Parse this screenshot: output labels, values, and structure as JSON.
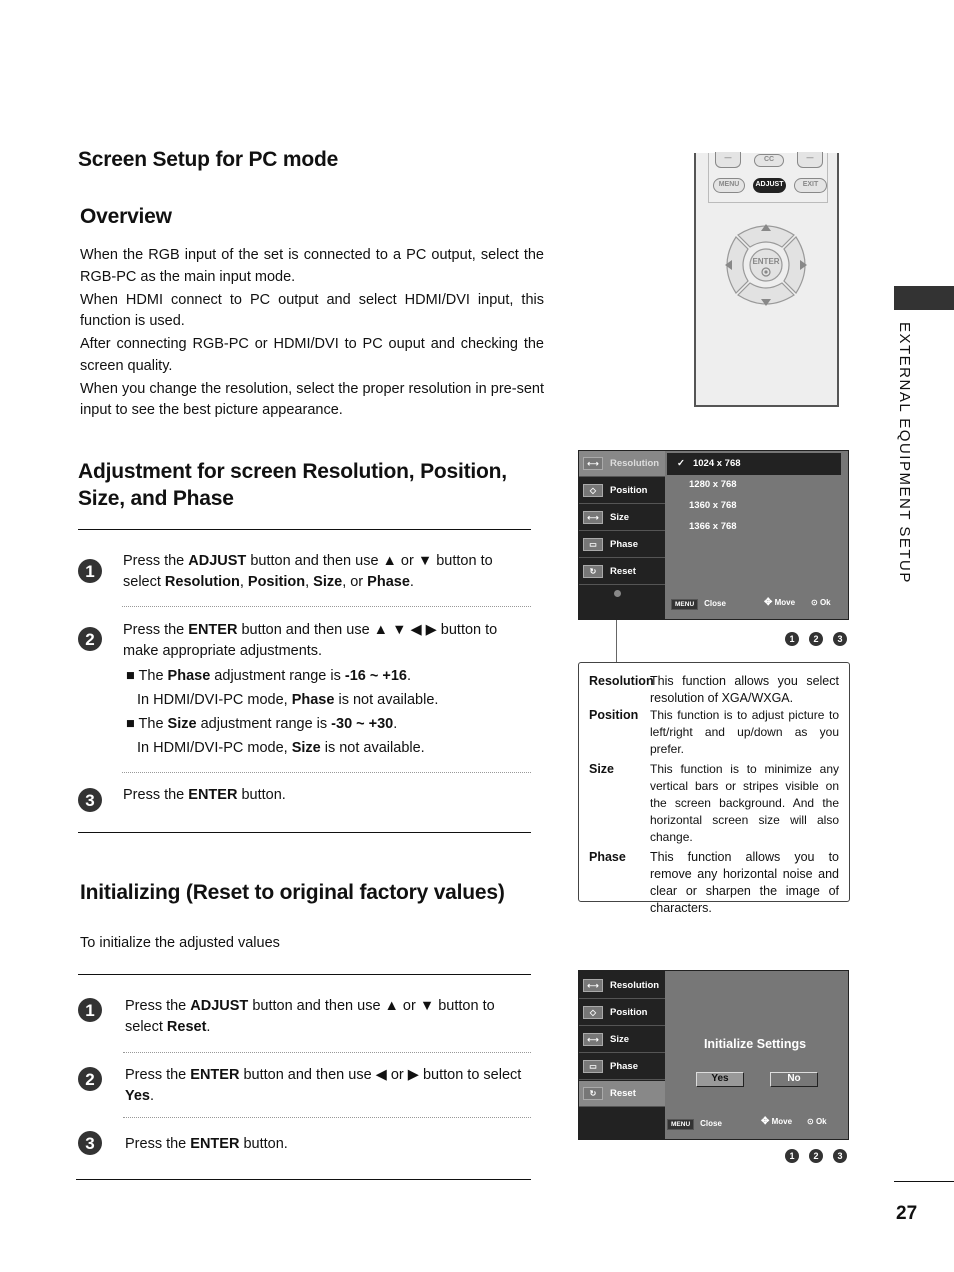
{
  "page": {
    "title": "Screen Setup for PC mode",
    "page_number": "27",
    "side_label": "EXTERNAL EQUIPMENT SETUP"
  },
  "overview": {
    "heading": "Overview",
    "paragraphs": [
      "When the RGB input of the set is connected to a PC output, select the RGB-PC as the main input mode.",
      "When HDMI connect to PC output and select HDMI/DVI input, this function is used.",
      "After connecting RGB-PC or HDMI/DVI to PC ouput and checking the screen quality.",
      "When you change the resolution, select the proper resolution in pre-sent input to see the best picture appearance."
    ]
  },
  "adjustment": {
    "heading": "Adjustment for screen Resolution, Position, Size, and Phase",
    "steps": [
      {
        "num": "1",
        "parts": [
          "Press the ",
          "ADJUST",
          " button and then use ▲ or ▼ button to select ",
          "Resolution",
          ", ",
          "Position",
          ", ",
          "Size",
          ", or ",
          "Phase",
          "."
        ]
      },
      {
        "num": "2",
        "parts": [
          "Press the ",
          "ENTER",
          " button and then use ▲ ▼ ◀ ▶ button to make appropriate adjustments."
        ]
      },
      {
        "num": "3",
        "parts": [
          "Press the ",
          "ENTER",
          " button."
        ]
      }
    ],
    "notes": [
      {
        "parts": [
          "■ The ",
          "Phase",
          " adjustment range is ",
          "-16 ~ +16",
          "."
        ],
        "sub": [
          "In HDMI/DVI-PC mode, ",
          "Phase",
          " is not available."
        ]
      },
      {
        "parts": [
          "■ The ",
          "Size",
          " adjustment range is ",
          "-30 ~ +30",
          "."
        ],
        "sub": [
          "In HDMI/DVI-PC mode, ",
          "Size",
          " is not available."
        ]
      }
    ]
  },
  "initializing": {
    "heading": "Initializing (Reset to original factory values)",
    "subheading": "To initialize the adjusted values",
    "steps": [
      {
        "num": "1",
        "parts": [
          "Press the ",
          "ADJUST",
          " button and then use ▲ or ▼ button to select ",
          "Reset",
          "."
        ]
      },
      {
        "num": "2",
        "parts": [
          "Press the ",
          "ENTER",
          " button and then use ◀ or ▶ button to select ",
          "Yes",
          "."
        ]
      },
      {
        "num": "3",
        "parts": [
          "Press the ",
          "ENTER",
          " button."
        ]
      }
    ]
  },
  "remote": {
    "buttons": {
      "cc": "CC",
      "menu": "MENU",
      "adjust": "ADJUST",
      "exit": "EXIT",
      "enter": "ENTER"
    }
  },
  "osd1": {
    "menu": [
      "Resolution",
      "Position",
      "Size",
      "Phase",
      "Reset"
    ],
    "selected_menu": "Resolution",
    "options": [
      "1024 x 768",
      "1280 x 768",
      "1360 x 768",
      "1366 x 768"
    ],
    "selected_option": "1024 x 768",
    "check": "✓",
    "footer": {
      "menu": "MENU",
      "close": "Close",
      "move": "Move",
      "ok": "Ok"
    },
    "step_markers": [
      "1",
      "2",
      "3"
    ]
  },
  "descriptions": [
    {
      "term": "Resolution",
      "def": "This function allows you select resolution of XGA/WXGA."
    },
    {
      "term": "Position",
      "def": "This function is to adjust picture to left/right and up/down as you prefer."
    },
    {
      "term": "Size",
      "def": "This function is to minimize any vertical bars or stripes visible on the screen background. And the horizontal screen size will also change."
    },
    {
      "term": "Phase",
      "def": "This function allows you to remove any horizontal noise and clear or sharpen the image of characters."
    }
  ],
  "osd2": {
    "menu": [
      "Resolution",
      "Position",
      "Size",
      "Phase",
      "Reset"
    ],
    "selected_menu": "Reset",
    "dialog_title": "Initialize Settings",
    "yes": "Yes",
    "no": "No",
    "footer": {
      "menu": "MENU",
      "close": "Close",
      "move": "Move",
      "ok": "Ok"
    },
    "step_markers": [
      "1",
      "2",
      "3"
    ]
  }
}
